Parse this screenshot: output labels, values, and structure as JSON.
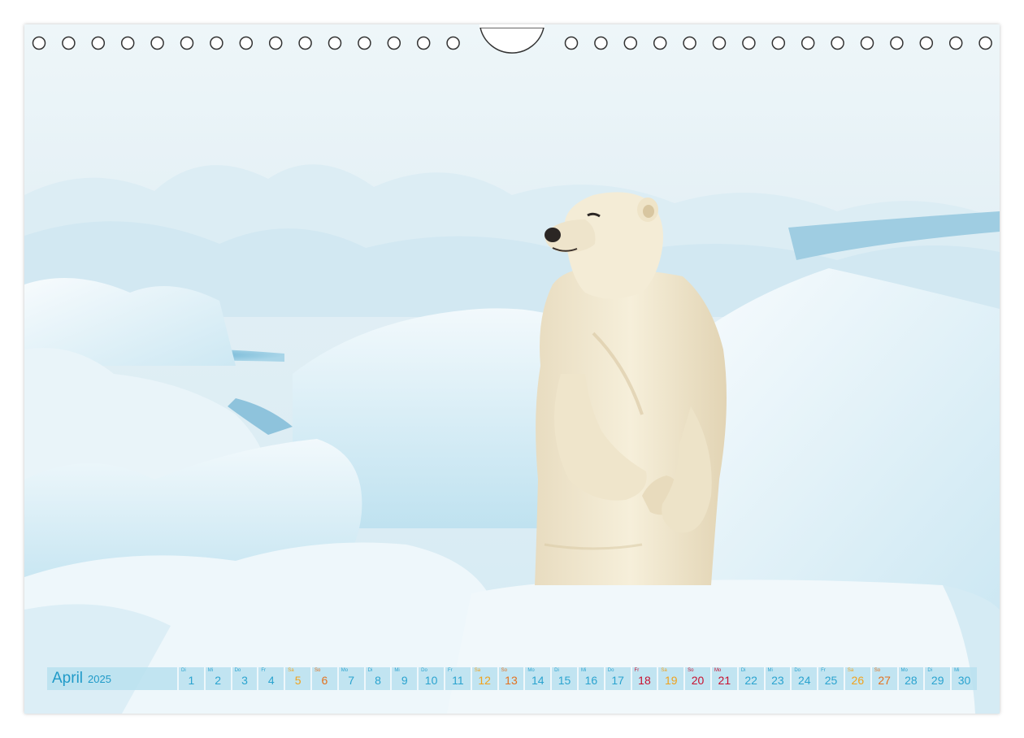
{
  "calendar": {
    "month": "April",
    "year": "2025",
    "days": [
      {
        "wd": "Di",
        "n": "1",
        "t": "w"
      },
      {
        "wd": "Mi",
        "n": "2",
        "t": "w"
      },
      {
        "wd": "Do",
        "n": "3",
        "t": "w"
      },
      {
        "wd": "Fr",
        "n": "4",
        "t": "w"
      },
      {
        "wd": "Sa",
        "n": "5",
        "t": "sat"
      },
      {
        "wd": "So",
        "n": "6",
        "t": "sun"
      },
      {
        "wd": "Mo",
        "n": "7",
        "t": "w"
      },
      {
        "wd": "Di",
        "n": "8",
        "t": "w"
      },
      {
        "wd": "Mi",
        "n": "9",
        "t": "w"
      },
      {
        "wd": "Do",
        "n": "10",
        "t": "w"
      },
      {
        "wd": "Fr",
        "n": "11",
        "t": "w"
      },
      {
        "wd": "Sa",
        "n": "12",
        "t": "sat"
      },
      {
        "wd": "So",
        "n": "13",
        "t": "sun"
      },
      {
        "wd": "Mo",
        "n": "14",
        "t": "w"
      },
      {
        "wd": "Di",
        "n": "15",
        "t": "w"
      },
      {
        "wd": "Mi",
        "n": "16",
        "t": "w"
      },
      {
        "wd": "Do",
        "n": "17",
        "t": "w"
      },
      {
        "wd": "Fr",
        "n": "18",
        "t": "hol"
      },
      {
        "wd": "Sa",
        "n": "19",
        "t": "sat"
      },
      {
        "wd": "So",
        "n": "20",
        "t": "hol"
      },
      {
        "wd": "Mo",
        "n": "21",
        "t": "hol"
      },
      {
        "wd": "Di",
        "n": "22",
        "t": "w"
      },
      {
        "wd": "Mi",
        "n": "23",
        "t": "w"
      },
      {
        "wd": "Do",
        "n": "24",
        "t": "w"
      },
      {
        "wd": "Fr",
        "n": "25",
        "t": "w"
      },
      {
        "wd": "Sa",
        "n": "26",
        "t": "sat"
      },
      {
        "wd": "So",
        "n": "27",
        "t": "sun"
      },
      {
        "wd": "Mo",
        "n": "28",
        "t": "w"
      },
      {
        "wd": "Di",
        "n": "29",
        "t": "w"
      },
      {
        "wd": "Mi",
        "n": "30",
        "t": "w"
      }
    ]
  },
  "colors": {
    "accent": "#1f9ac8",
    "saturday": "#f0a21c",
    "sunday": "#e3711e",
    "holiday": "#c8102e",
    "strip_bg": "#b8e1ee"
  },
  "photo": {
    "subject": "polar-bear-cub-standing-on-ice"
  }
}
